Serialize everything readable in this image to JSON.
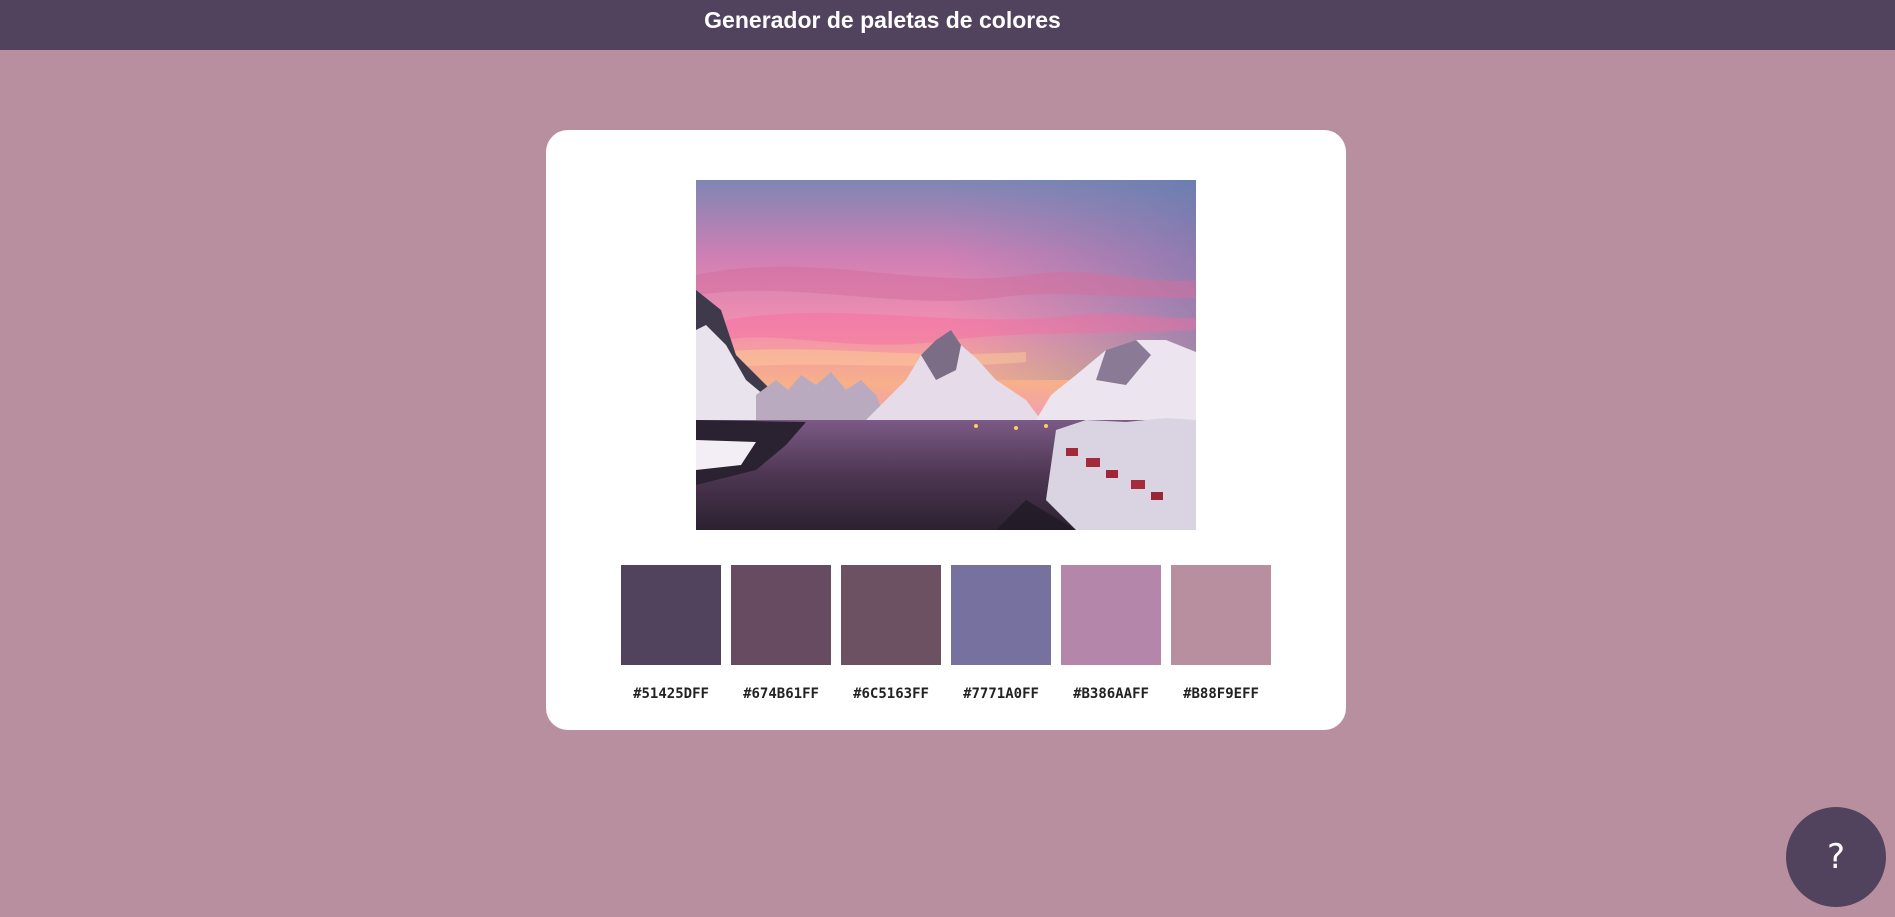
{
  "header": {
    "title": "Generador de paletas de colores"
  },
  "palette": [
    {
      "hex": "#51425DFF",
      "color": "#51425D"
    },
    {
      "hex": "#674B61FF",
      "color": "#674B61"
    },
    {
      "hex": "#6C5163FF",
      "color": "#6C5163"
    },
    {
      "hex": "#7771A0FF",
      "color": "#7771A0"
    },
    {
      "hex": "#B386AAFF",
      "color": "#B386AA"
    },
    {
      "hex": "#B88F9EFF",
      "color": "#B88F9E"
    }
  ],
  "help_button": {
    "label": "?"
  },
  "colors": {
    "page_background": "#B88F9E",
    "header_background": "#51425D",
    "card_background": "#FFFFFF",
    "help_button_background": "#51425D"
  }
}
